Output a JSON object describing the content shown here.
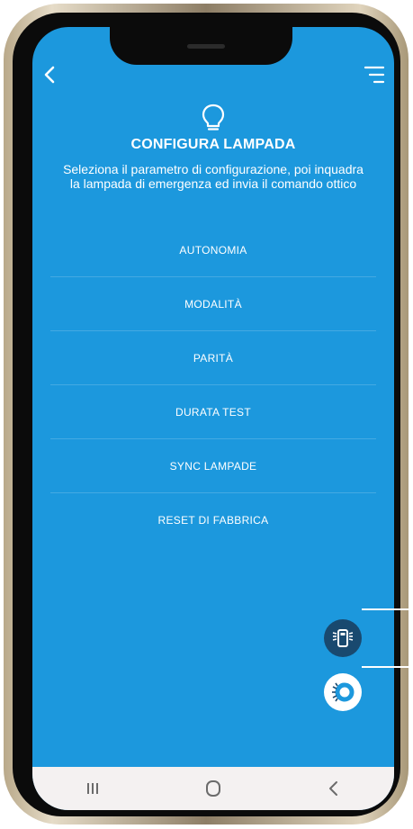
{
  "header": {
    "title": "CONFIGURA LAMPADA",
    "description": "Seleziona il parametro di configurazione, poi inquadra la lampada di emergenza ed invia il comando ottico"
  },
  "menu": {
    "items": [
      {
        "label": "AUTONOMIA"
      },
      {
        "label": "MODALITÀ"
      },
      {
        "label": "PARITÀ"
      },
      {
        "label": "DURATA TEST"
      },
      {
        "label": "SYNC LAMPADE"
      },
      {
        "label": "RESET DI FABBRICA"
      }
    ]
  },
  "colors": {
    "screen_bg": "#1c98dd",
    "fab_dark": "#19496f",
    "fab_light": "#ffffff",
    "navbar_bg": "#f4f1f1",
    "text": "#ffffff"
  },
  "icons": {
    "back": "chevron-left-icon",
    "menu": "menu-lines-icon",
    "bulb": "lightbulb-icon",
    "fab1": "emergency-lamp-icon",
    "fab2": "optical-signal-icon",
    "nav_recent": "recent-apps-icon",
    "nav_home": "home-icon",
    "nav_back": "back-icon"
  }
}
